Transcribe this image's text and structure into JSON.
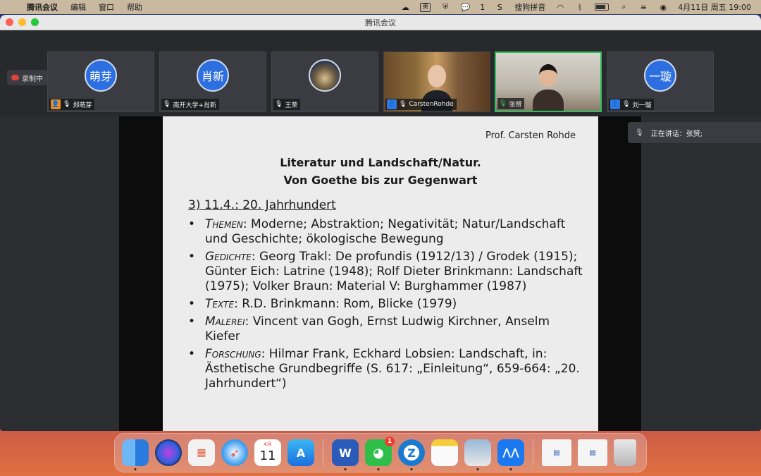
{
  "menubar": {
    "app_name": "腾讯会议",
    "menus": [
      "编辑",
      "窗口",
      "帮助"
    ],
    "ime_label": "英",
    "wechat_count": "1",
    "sogou_label": "搜狗拼音",
    "datetime": "4月11日 周五  19:00"
  },
  "window": {
    "title": "腾讯会议",
    "recording_label": "录制中"
  },
  "participants": [
    {
      "name": "郑萌芽",
      "avatar_text": "萌芽",
      "type": "avatar"
    },
    {
      "name": "南开大学+肖新",
      "avatar_text": "肖新",
      "type": "avatar"
    },
    {
      "name": "王荣",
      "avatar_text": "",
      "type": "photo"
    },
    {
      "name": "CarstenRohde",
      "avatar_text": "",
      "type": "video1"
    },
    {
      "name": "张赟",
      "avatar_text": "",
      "type": "video2"
    },
    {
      "name": "刘一璇",
      "avatar_text": "一璇",
      "type": "avatar"
    }
  ],
  "speaking": {
    "label": "正在讲话：",
    "name": "张赟;"
  },
  "slide": {
    "author": "Prof. Carsten Rohde",
    "title_line1": "Literatur und Landschaft/Natur.",
    "title_line2": "Von Goethe bis zur Gegenwart",
    "section": "3) 11.4.: 20. Jahrhundert",
    "bullets": [
      {
        "category": "Themen",
        "text": ": Moderne; Abstraktion; Negativität; Natur/Landschaft und Geschichte; ökologische Bewegung"
      },
      {
        "category": "Gedichte",
        "text": ": Georg Trakl: De profundis (1912/13) / Grodek (1915); Günter Eich: Latrine (1948); Rolf Dieter Brinkmann: Landschaft (1975); Volker Braun: Material V: Burghammer (1987)"
      },
      {
        "category": "Texte",
        "text": ": R.D. Brinkmann: Rom, Blicke (1979)"
      },
      {
        "category": "Malerei",
        "text": ": Vincent van Gogh, Ernst Ludwig Kirchner, Anselm Kiefer"
      },
      {
        "category": "Forschung",
        "text": ": Hilmar Frank, Eckhard Lobsien: Landschaft, in: Ästhetische Grundbegriffe (S. 617: „Einleitung“, 659-664: „20. Jahrhundert“)"
      }
    ]
  },
  "dock": {
    "calendar_month": "4月",
    "calendar_day": "11",
    "wechat_badge": "1",
    "word_letter": "W"
  }
}
